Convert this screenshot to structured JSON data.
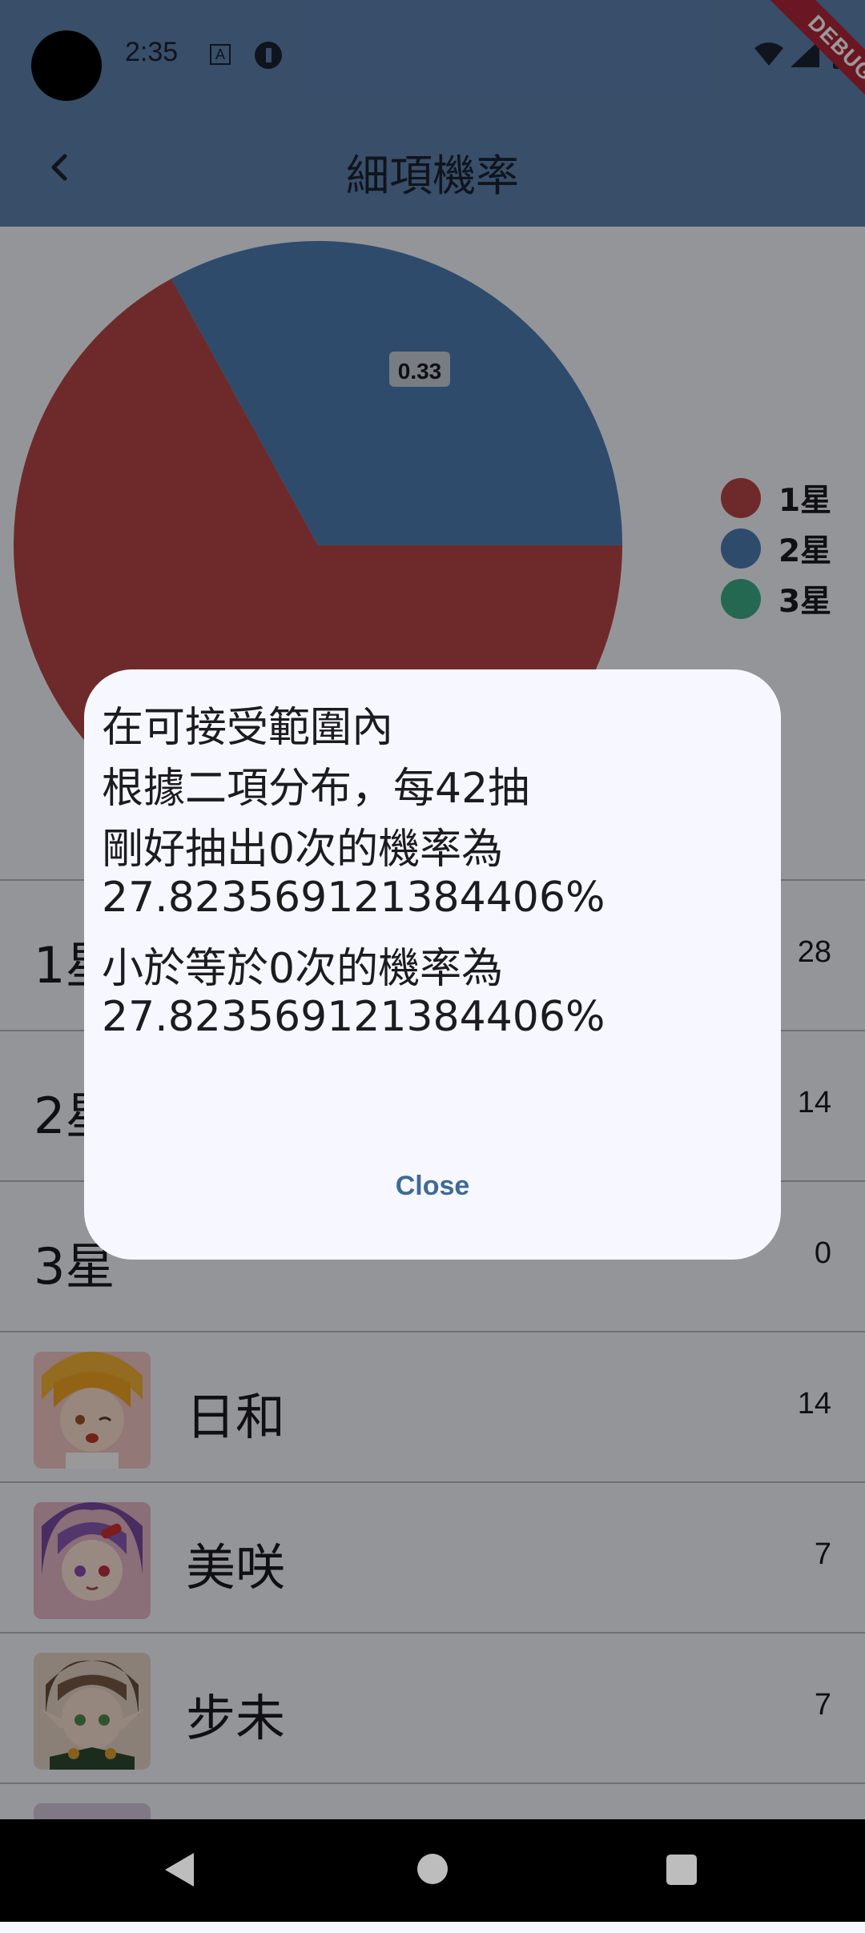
{
  "status_bar": {
    "time": "2:35",
    "debug_label": "DEBUG"
  },
  "app_bar": {
    "title": "細項機率"
  },
  "chart_data": {
    "type": "pie",
    "slices": [
      {
        "name": "1星",
        "value": 0.67,
        "color": "#b84646"
      },
      {
        "name": "2星",
        "value": 0.33,
        "color": "#4d7db5"
      },
      {
        "name": "3星",
        "value": 0.0,
        "color": "#3fae87"
      }
    ],
    "data_labels": [
      "0.33"
    ],
    "legend_position": "right"
  },
  "legend": [
    {
      "label": "1星",
      "color": "#b84646"
    },
    {
      "label": "2星",
      "color": "#4d7db5"
    },
    {
      "label": "3星",
      "color": "#3fae87"
    }
  ],
  "list": {
    "rows": [
      {
        "label": "1星",
        "count": "28"
      },
      {
        "label": "2星",
        "count": "14"
      },
      {
        "label": "3星",
        "count": "0"
      },
      {
        "label": "日和",
        "count": "14"
      },
      {
        "label": "美咲",
        "count": "7"
      },
      {
        "label": "步未",
        "count": "7"
      }
    ]
  },
  "dialog": {
    "lines": [
      "在可接受範圍內",
      "根據二項分布，每42抽",
      "剛好抽出0次的機率為",
      "27.823569121384406%",
      "小於等於0次的機率為",
      "27.823569121384406%"
    ],
    "close_label": "Close"
  }
}
